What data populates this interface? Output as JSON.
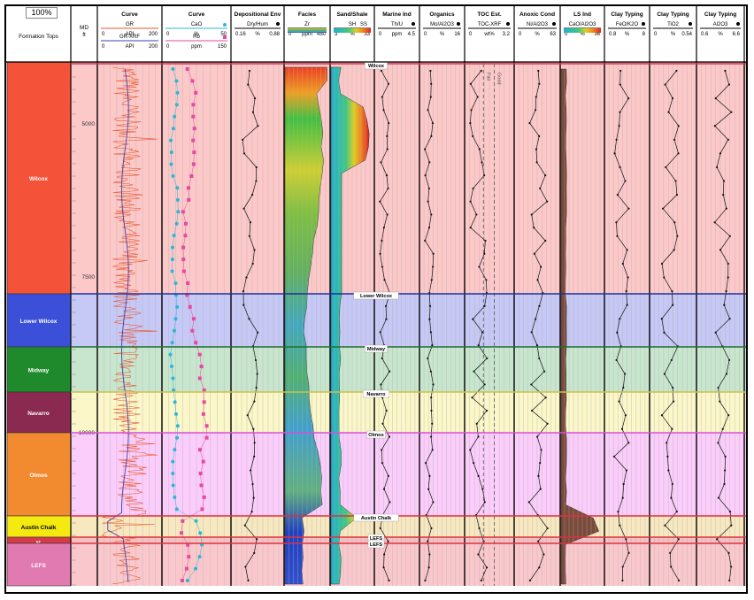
{
  "toolbar": {
    "zoom": "100%"
  },
  "header": {
    "formation_tops": "Formation Tops",
    "md_label": "MD",
    "md_unit": "ft"
  },
  "depth_labels": [
    "5000",
    "7500",
    "10000"
  ],
  "formations": [
    {
      "name": "Wilcox",
      "color": "#f4533a",
      "band": "#fdc8c8",
      "line": "#d8304a"
    },
    {
      "name": "Lower Wilcox",
      "color": "#3b4fd8",
      "band": "#c6c8f6",
      "line": "#1f2f99"
    },
    {
      "name": "Midway",
      "color": "#1e8a2c",
      "band": "#c8e6ce",
      "line": "#1f6f2f"
    },
    {
      "name": "Navarro",
      "color": "#8a2a50",
      "band": "#fbf7c8",
      "line": "#c9c24a"
    },
    {
      "name": "Olmos",
      "color": "#f28a30",
      "band": "#fbcdfb",
      "line": "#d84fd8"
    },
    {
      "name": "Austin Chalk",
      "color": "#f4ea10",
      "band": "#f7e8c0",
      "line": "#e03040"
    },
    {
      "name": "EF",
      "color": "#d83a48",
      "band": "#f4c0c0",
      "line": "#e03040"
    },
    {
      "name": "LEFS",
      "color": "#e07ab0",
      "band": "#fac8cc",
      "line": "#e03040"
    }
  ],
  "marker_labels": {
    "wilcox": "Wilcox",
    "lower_wilcox": "Lower Wilcox",
    "midway": "Midway",
    "navarro": "Navarro",
    "olmos": "Olmos",
    "austin_chalk": "Austin Chalk",
    "lefs1": "LEFS",
    "lefs2": "LEFS"
  },
  "tracks": [
    {
      "title": "Curve",
      "curves": [
        {
          "name": "GR",
          "min": "0",
          "unit": "API",
          "max": "200",
          "color": "#e8542a"
        },
        {
          "name": "GR-XRF",
          "min": "0",
          "unit": "API",
          "max": "200",
          "color": "#3a40b0"
        }
      ]
    },
    {
      "title": "Curve",
      "curves": [
        {
          "name": "CaO",
          "min": "0",
          "unit": "%",
          "max": "50",
          "color": "#2bb6d6"
        },
        {
          "name": "Rb",
          "min": "0",
          "unit": "ppm",
          "max": "150",
          "color": "#e64aa0"
        }
      ]
    },
    {
      "title": "Depositional Env",
      "curves": [
        {
          "name": "Dry/Hum",
          "min": "0.16",
          "unit": "%",
          "max": "0.88"
        }
      ]
    },
    {
      "title": "Facies",
      "curves": [
        {
          "name": "Zr",
          "min": "0",
          "unit": "ppm",
          "max": "450"
        }
      ]
    },
    {
      "title": "Sand/Shale",
      "curves": [
        {
          "name": "SH",
          "name2": "SS",
          "min": "3",
          "unit": "%",
          "max": "33"
        }
      ]
    },
    {
      "title": "Marine Ind",
      "curves": [
        {
          "name": "Th/U",
          "min": "0",
          "unit": "ppm",
          "max": "4.5"
        }
      ]
    },
    {
      "title": "Organics",
      "curves": [
        {
          "name": "Mo/Al2O3",
          "min": "0",
          "unit": "%",
          "max": "16"
        }
      ]
    },
    {
      "title": "TOC Est.",
      "curves": [
        {
          "name": "TOC-XRF",
          "min": "0",
          "unit": "wt%",
          "max": "3.2"
        }
      ],
      "markers": [
        "Fair",
        "Good"
      ]
    },
    {
      "title": "Anoxic Cond",
      "curves": [
        {
          "name": "Ni/Al2O3",
          "min": "0",
          "unit": "%",
          "max": "63"
        }
      ]
    },
    {
      "title": "LS Ind",
      "curves": [
        {
          "name": "CaO/Al2O3",
          "min": "0",
          "unit": "%",
          "max": "36"
        }
      ]
    },
    {
      "title": "Clay Typing",
      "curves": [
        {
          "name": "FeO/K2O",
          "min": "0.8",
          "unit": "%",
          "max": "8"
        }
      ]
    },
    {
      "title": "Clay Typing",
      "curves": [
        {
          "name": "TiO2",
          "min": "0",
          "unit": "%",
          "max": "0.54"
        }
      ]
    },
    {
      "title": "Clay Typing",
      "curves": [
        {
          "name": "Al2O3",
          "min": "0.6",
          "unit": "%",
          "max": "6.6"
        }
      ]
    }
  ]
}
